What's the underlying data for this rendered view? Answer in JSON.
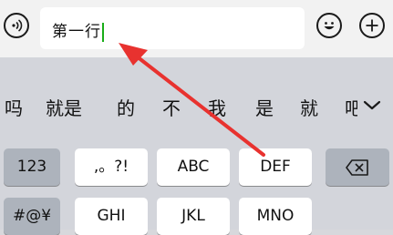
{
  "input": {
    "value": "第一行"
  },
  "candidates": [
    "吗",
    "就是",
    "的",
    "不",
    "我",
    "是",
    "就",
    "吧"
  ],
  "keys": {
    "row1": [
      "123",
      ",。?!",
      "ABC",
      "DEF"
    ],
    "row2": [
      "#@¥",
      "GHI",
      "JKL",
      "MNO"
    ]
  },
  "icons": {
    "voice": "voice-toggle-icon",
    "emoji": "emoji-icon",
    "plus": "plus-icon",
    "backspace": "backspace-icon",
    "chevron": "chevron-down-icon"
  },
  "colors": {
    "caret": "#1aad19",
    "arrow": "#e8322f"
  }
}
